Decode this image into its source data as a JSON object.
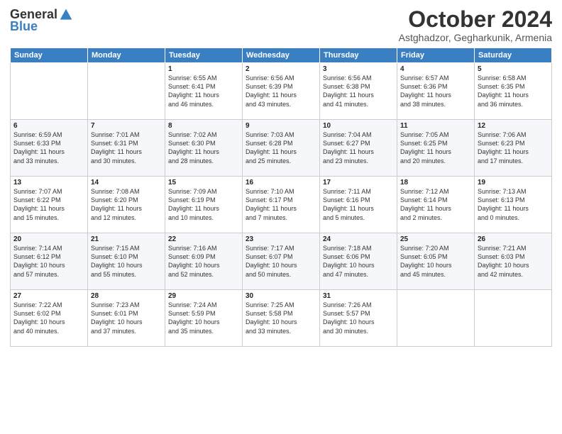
{
  "logo": {
    "general": "General",
    "blue": "Blue"
  },
  "title": "October 2024",
  "subtitle": "Astghadzor, Gegharkunik, Armenia",
  "days_header": [
    "Sunday",
    "Monday",
    "Tuesday",
    "Wednesday",
    "Thursday",
    "Friday",
    "Saturday"
  ],
  "weeks": [
    [
      {
        "day": "",
        "content": ""
      },
      {
        "day": "",
        "content": ""
      },
      {
        "day": "1",
        "content": "Sunrise: 6:55 AM\nSunset: 6:41 PM\nDaylight: 11 hours\nand 46 minutes."
      },
      {
        "day": "2",
        "content": "Sunrise: 6:56 AM\nSunset: 6:39 PM\nDaylight: 11 hours\nand 43 minutes."
      },
      {
        "day": "3",
        "content": "Sunrise: 6:56 AM\nSunset: 6:38 PM\nDaylight: 11 hours\nand 41 minutes."
      },
      {
        "day": "4",
        "content": "Sunrise: 6:57 AM\nSunset: 6:36 PM\nDaylight: 11 hours\nand 38 minutes."
      },
      {
        "day": "5",
        "content": "Sunrise: 6:58 AM\nSunset: 6:35 PM\nDaylight: 11 hours\nand 36 minutes."
      }
    ],
    [
      {
        "day": "6",
        "content": "Sunrise: 6:59 AM\nSunset: 6:33 PM\nDaylight: 11 hours\nand 33 minutes."
      },
      {
        "day": "7",
        "content": "Sunrise: 7:01 AM\nSunset: 6:31 PM\nDaylight: 11 hours\nand 30 minutes."
      },
      {
        "day": "8",
        "content": "Sunrise: 7:02 AM\nSunset: 6:30 PM\nDaylight: 11 hours\nand 28 minutes."
      },
      {
        "day": "9",
        "content": "Sunrise: 7:03 AM\nSunset: 6:28 PM\nDaylight: 11 hours\nand 25 minutes."
      },
      {
        "day": "10",
        "content": "Sunrise: 7:04 AM\nSunset: 6:27 PM\nDaylight: 11 hours\nand 23 minutes."
      },
      {
        "day": "11",
        "content": "Sunrise: 7:05 AM\nSunset: 6:25 PM\nDaylight: 11 hours\nand 20 minutes."
      },
      {
        "day": "12",
        "content": "Sunrise: 7:06 AM\nSunset: 6:23 PM\nDaylight: 11 hours\nand 17 minutes."
      }
    ],
    [
      {
        "day": "13",
        "content": "Sunrise: 7:07 AM\nSunset: 6:22 PM\nDaylight: 11 hours\nand 15 minutes."
      },
      {
        "day": "14",
        "content": "Sunrise: 7:08 AM\nSunset: 6:20 PM\nDaylight: 11 hours\nand 12 minutes."
      },
      {
        "day": "15",
        "content": "Sunrise: 7:09 AM\nSunset: 6:19 PM\nDaylight: 11 hours\nand 10 minutes."
      },
      {
        "day": "16",
        "content": "Sunrise: 7:10 AM\nSunset: 6:17 PM\nDaylight: 11 hours\nand 7 minutes."
      },
      {
        "day": "17",
        "content": "Sunrise: 7:11 AM\nSunset: 6:16 PM\nDaylight: 11 hours\nand 5 minutes."
      },
      {
        "day": "18",
        "content": "Sunrise: 7:12 AM\nSunset: 6:14 PM\nDaylight: 11 hours\nand 2 minutes."
      },
      {
        "day": "19",
        "content": "Sunrise: 7:13 AM\nSunset: 6:13 PM\nDaylight: 11 hours\nand 0 minutes."
      }
    ],
    [
      {
        "day": "20",
        "content": "Sunrise: 7:14 AM\nSunset: 6:12 PM\nDaylight: 10 hours\nand 57 minutes."
      },
      {
        "day": "21",
        "content": "Sunrise: 7:15 AM\nSunset: 6:10 PM\nDaylight: 10 hours\nand 55 minutes."
      },
      {
        "day": "22",
        "content": "Sunrise: 7:16 AM\nSunset: 6:09 PM\nDaylight: 10 hours\nand 52 minutes."
      },
      {
        "day": "23",
        "content": "Sunrise: 7:17 AM\nSunset: 6:07 PM\nDaylight: 10 hours\nand 50 minutes."
      },
      {
        "day": "24",
        "content": "Sunrise: 7:18 AM\nSunset: 6:06 PM\nDaylight: 10 hours\nand 47 minutes."
      },
      {
        "day": "25",
        "content": "Sunrise: 7:20 AM\nSunset: 6:05 PM\nDaylight: 10 hours\nand 45 minutes."
      },
      {
        "day": "26",
        "content": "Sunrise: 7:21 AM\nSunset: 6:03 PM\nDaylight: 10 hours\nand 42 minutes."
      }
    ],
    [
      {
        "day": "27",
        "content": "Sunrise: 7:22 AM\nSunset: 6:02 PM\nDaylight: 10 hours\nand 40 minutes."
      },
      {
        "day": "28",
        "content": "Sunrise: 7:23 AM\nSunset: 6:01 PM\nDaylight: 10 hours\nand 37 minutes."
      },
      {
        "day": "29",
        "content": "Sunrise: 7:24 AM\nSunset: 5:59 PM\nDaylight: 10 hours\nand 35 minutes."
      },
      {
        "day": "30",
        "content": "Sunrise: 7:25 AM\nSunset: 5:58 PM\nDaylight: 10 hours\nand 33 minutes."
      },
      {
        "day": "31",
        "content": "Sunrise: 7:26 AM\nSunset: 5:57 PM\nDaylight: 10 hours\nand 30 minutes."
      },
      {
        "day": "",
        "content": ""
      },
      {
        "day": "",
        "content": ""
      }
    ]
  ]
}
